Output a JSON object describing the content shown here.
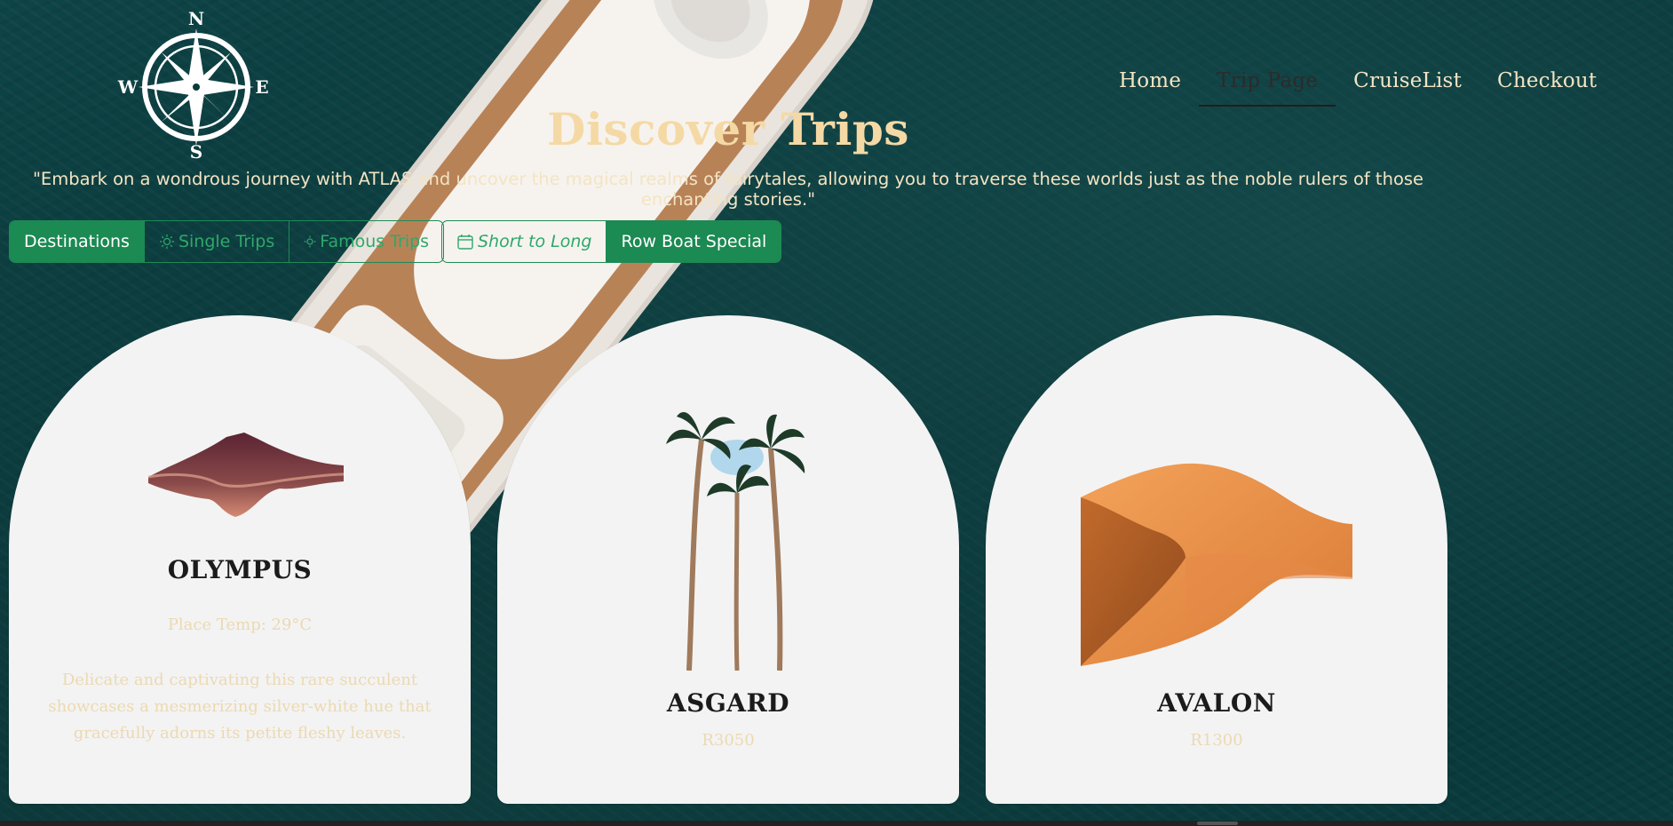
{
  "logo": {
    "n": "N",
    "s": "S",
    "e": "E",
    "w": "W",
    "icon": "compass-icon"
  },
  "nav": [
    {
      "label": "Home"
    },
    {
      "label": "Trip Page"
    },
    {
      "label": "CruiseList"
    },
    {
      "label": "Checkout"
    }
  ],
  "hero": {
    "title": "Discover Trips",
    "tagline": "\"Embark on a wondrous journey with ATLAS and uncover the magical realms of fairytales, allowing you to traverse these worlds just as the noble rulers of those enchanting stories.\""
  },
  "filters": {
    "destinations": "Destinations",
    "single_trips": "Single Trips",
    "famous_trips": "Famous Trips",
    "short_to_long": "Short to Long",
    "row_boat": "Row Boat Special"
  },
  "cards": [
    {
      "name": "OLYMPUS",
      "temp": "Place Temp: 29°C",
      "description": "Delicate and captivating this rare succulent showcases a mesmerizing silver-white hue that gracefully adorns its petite fleshy leaves.",
      "image_icon": "mountain-icon"
    },
    {
      "name": "ASGARD",
      "price": "R3050",
      "image_icon": "palm-trees-icon"
    },
    {
      "name": "AVALON",
      "price": "R1300",
      "image_icon": "sand-dune-icon"
    }
  ],
  "colors": {
    "accent": "#1b8a53",
    "title": "#f5d9a5",
    "card": "#f3f3f3",
    "sea": "#0b3a3b"
  }
}
